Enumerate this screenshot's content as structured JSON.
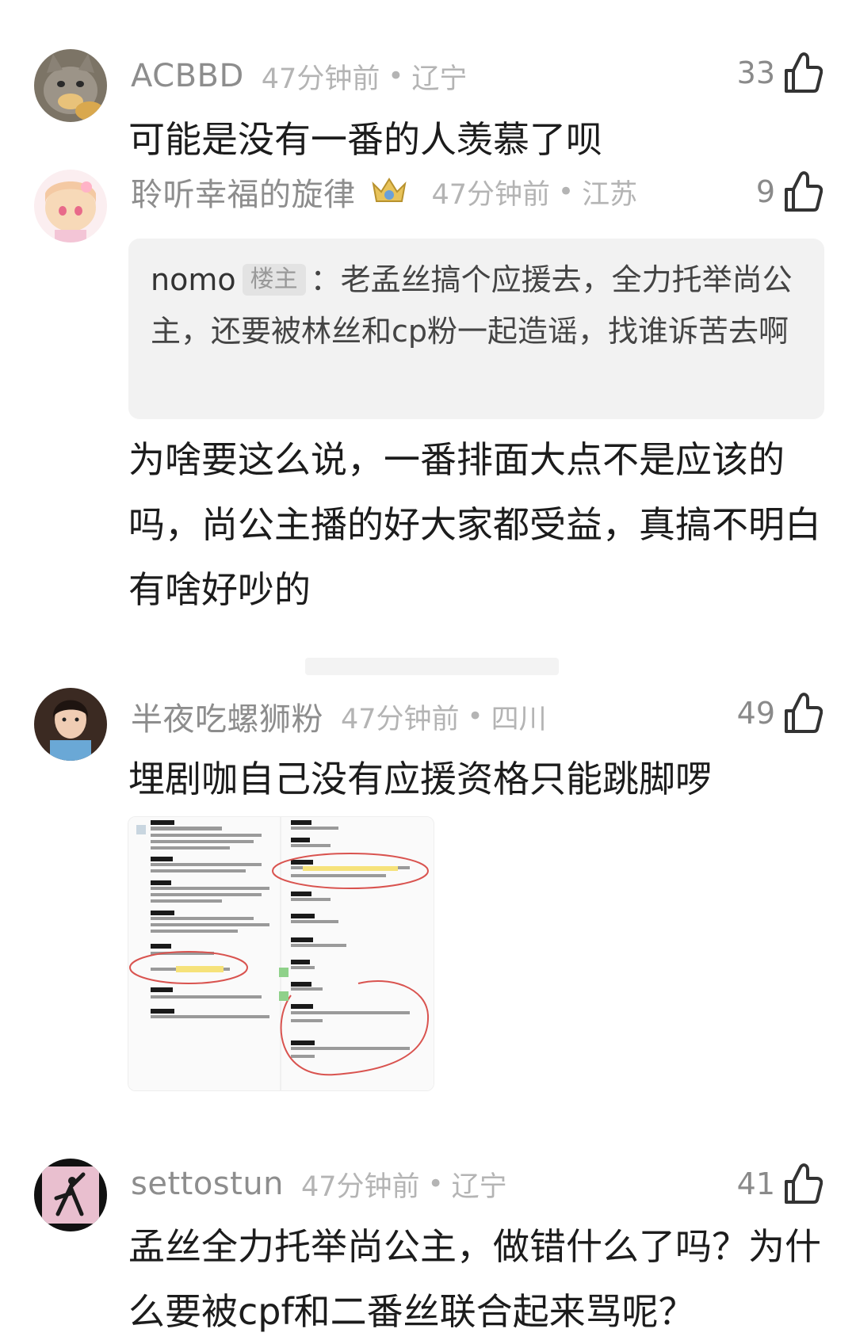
{
  "comments": [
    {
      "username": "ACBBD",
      "time": "47分钟前",
      "location": "辽宁",
      "likes": "33",
      "text": "可能是没有一番的人羡慕了呗",
      "avatar_icon": "cat-avatar-icon"
    },
    {
      "username": "聆听幸福的旋律",
      "badge_icon": "crown-badge-icon",
      "time": "47分钟前",
      "location": "江苏",
      "likes": "9",
      "quote": {
        "author": "nomo",
        "author_tag": "楼主",
        "text": "老孟丝搞个应援去，全力托举尚公主，还要被林丝和cp粉一起造谣，找谁诉苦去啊"
      },
      "text": "为啥要这么说，一番排面大点不是应该的吗，尚公主播的好大家都受益，真搞不明白有啥好吵的",
      "avatar_icon": "anime-girl-avatar-icon"
    },
    {
      "username": "半夜吃螺狮粉",
      "time": "47分钟前",
      "location": "四川",
      "likes": "49",
      "text": "埋剧咖自己没有应援资格只能跳脚啰",
      "image_icon": "chat-screenshot-image",
      "avatar_icon": "woman-photo-avatar-icon"
    },
    {
      "username": "settostun",
      "time": "47分钟前",
      "location": "辽宁",
      "likes": "41",
      "text": "孟丝全力托举尚公主，做错什么了吗？为什么要被cpf和二番丝联合起来骂呢？",
      "avatar_icon": "dancer-avatar-icon"
    }
  ],
  "separator_dot": "•",
  "colors": {
    "username": "#8d8d8d",
    "meta": "#b4b4b4",
    "text": "#1c1c1c",
    "quote_bg": "#f2f2f2",
    "highlight_circle": "#d9534f"
  }
}
